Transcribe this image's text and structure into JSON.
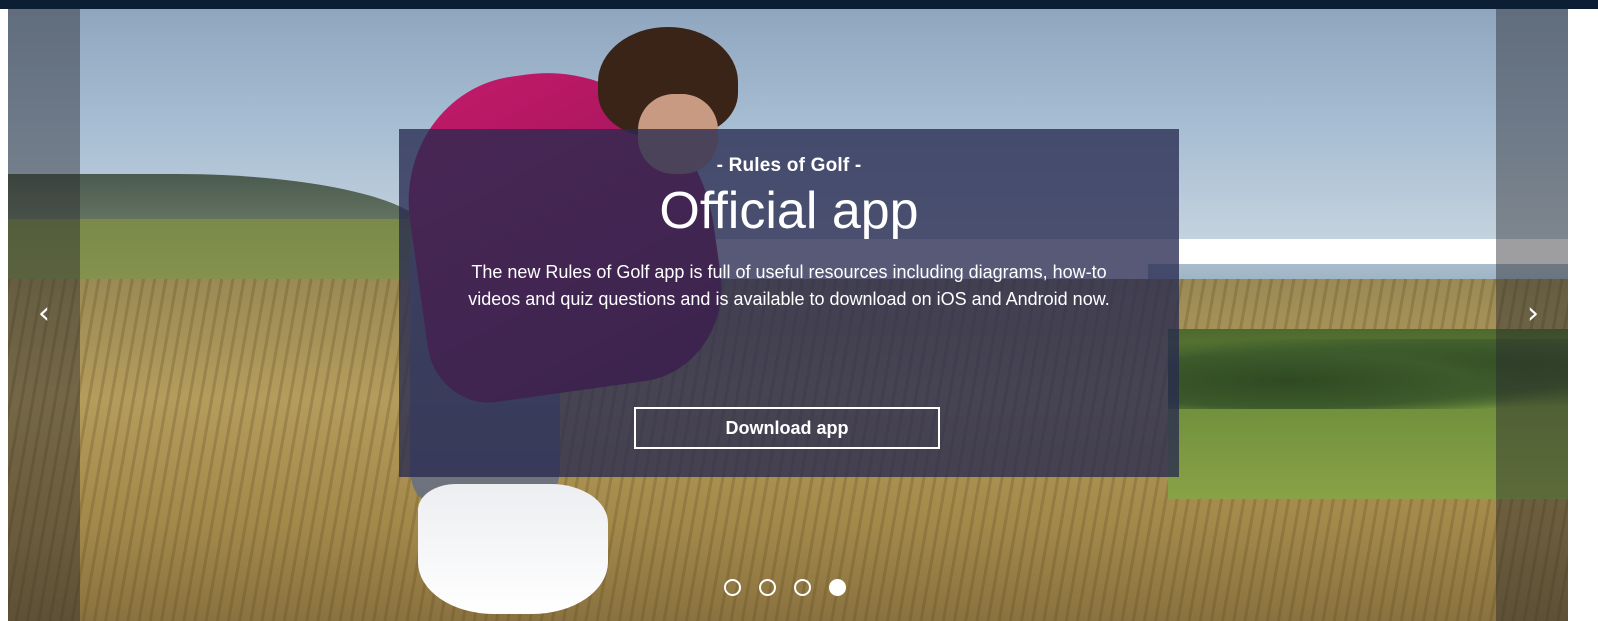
{
  "slide": {
    "eyebrow": "- Rules of Golf -",
    "headline": "Official app",
    "description": "The new Rules of Golf app is full of useful resources including diagrams, how-to videos and quiz questions and is available to download on iOS and Android now.",
    "cta_label": "Download app"
  },
  "navigation": {
    "prev_icon": "chevron-left-icon",
    "next_icon": "chevron-right-icon",
    "prev_glyph": "‹",
    "next_glyph": "›"
  },
  "pagination": {
    "total": 4,
    "active_index": 3
  },
  "colors": {
    "top_bar": "#0b1e33",
    "card_overlay": "#282a50",
    "text": "#ffffff"
  }
}
